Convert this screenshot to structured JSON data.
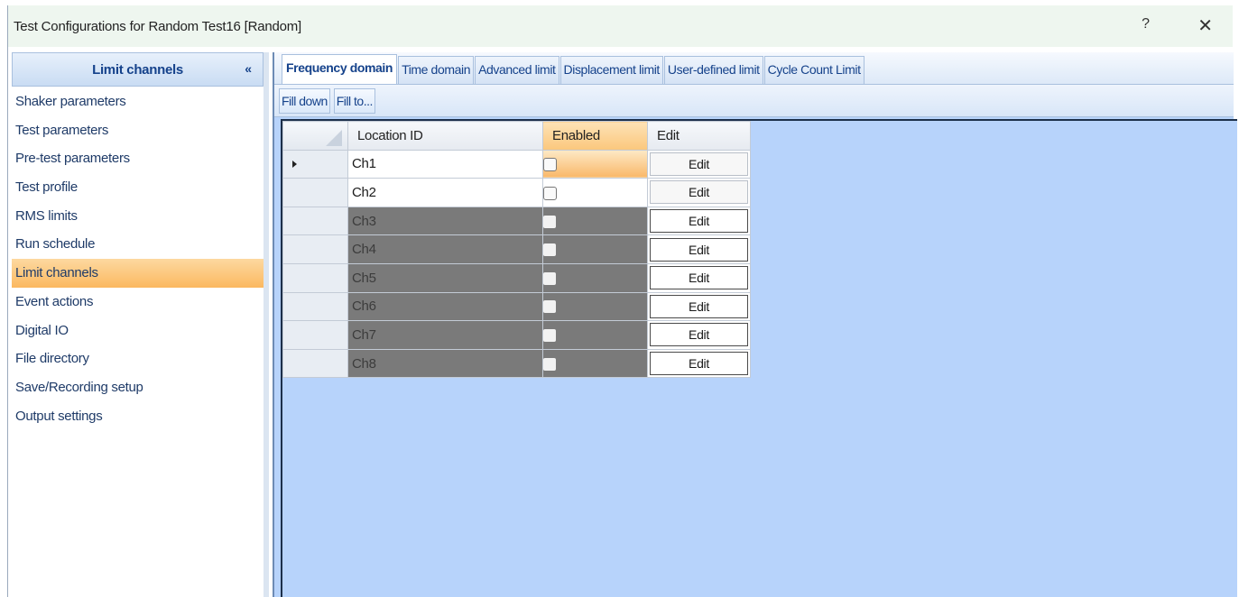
{
  "window": {
    "title": "Test Configurations for Random Test16 [Random]",
    "help_label": "?",
    "close_label": "✕"
  },
  "sidebar": {
    "header": "Limit channels",
    "collapse_label": "«",
    "items": [
      {
        "label": "Shaker parameters",
        "active": false
      },
      {
        "label": "Test parameters",
        "active": false
      },
      {
        "label": "Pre-test parameters",
        "active": false
      },
      {
        "label": "Test profile",
        "active": false
      },
      {
        "label": "RMS limits",
        "active": false
      },
      {
        "label": "Run schedule",
        "active": false
      },
      {
        "label": "Limit channels",
        "active": true
      },
      {
        "label": "Event actions",
        "active": false
      },
      {
        "label": "Digital IO",
        "active": false
      },
      {
        "label": "File directory",
        "active": false
      },
      {
        "label": "Save/Recording setup",
        "active": false
      },
      {
        "label": "Output settings",
        "active": false
      }
    ]
  },
  "tabs": [
    {
      "label": "Frequency domain",
      "active": true
    },
    {
      "label": "Time domain",
      "active": false
    },
    {
      "label": "Advanced limit",
      "active": false
    },
    {
      "label": "Displacement limit",
      "active": false
    },
    {
      "label": "User-defined limit",
      "active": false
    },
    {
      "label": "Cycle Count Limit",
      "active": false
    }
  ],
  "toolbar": {
    "fill_down_label": "Fill down",
    "fill_to_label": "Fill to..."
  },
  "grid": {
    "columns": {
      "location_id": "Location ID",
      "enabled": "Enabled",
      "edit": "Edit"
    },
    "rows": [
      {
        "location_id": "Ch1",
        "enabled": false,
        "available": true,
        "current": true,
        "edit_label": "Edit"
      },
      {
        "location_id": "Ch2",
        "enabled": false,
        "available": true,
        "current": false,
        "edit_label": "Edit"
      },
      {
        "location_id": "Ch3",
        "enabled": false,
        "available": false,
        "current": false,
        "edit_label": "Edit"
      },
      {
        "location_id": "Ch4",
        "enabled": false,
        "available": false,
        "current": false,
        "edit_label": "Edit"
      },
      {
        "location_id": "Ch5",
        "enabled": false,
        "available": false,
        "current": false,
        "edit_label": "Edit"
      },
      {
        "location_id": "Ch6",
        "enabled": false,
        "available": false,
        "current": false,
        "edit_label": "Edit"
      },
      {
        "location_id": "Ch7",
        "enabled": false,
        "available": false,
        "current": false,
        "edit_label": "Edit"
      },
      {
        "location_id": "Ch8",
        "enabled": false,
        "available": false,
        "current": false,
        "edit_label": "Edit"
      }
    ]
  },
  "colors": {
    "accent_orange": "#fbb860",
    "grid_background": "#b7d3fb",
    "disabled_row": "#7a7a7a",
    "header_text": "#15428b"
  }
}
